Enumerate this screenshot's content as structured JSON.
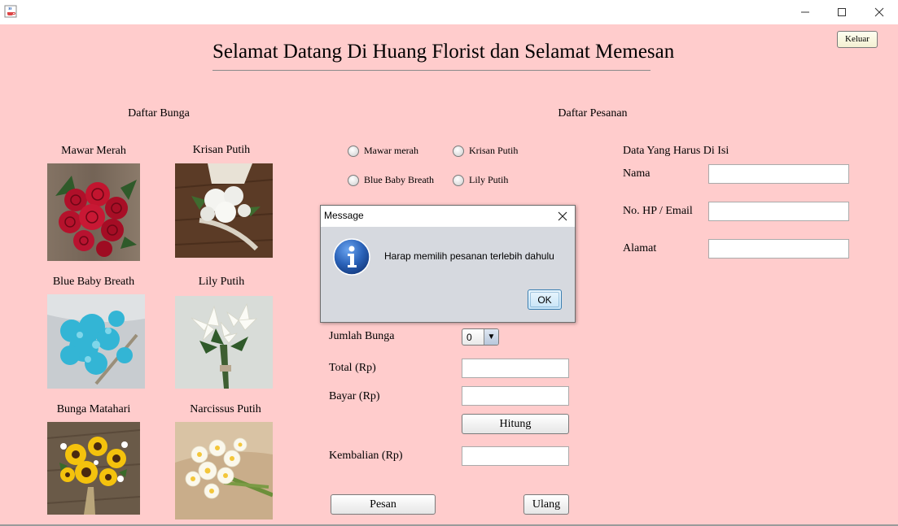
{
  "window": {
    "app_icon": "java-cup-icon",
    "controls": [
      "minimize-icon",
      "maximize-icon",
      "close-icon"
    ]
  },
  "header": {
    "title": "Selamat Datang Di Huang Florist dan Selamat Memesan",
    "exit_label": "Keluar"
  },
  "flowers": {
    "section_label": "Daftar Bunga",
    "items": [
      {
        "name": "Mawar Merah"
      },
      {
        "name": "Krisan Putih"
      },
      {
        "name": "Blue Baby Breath"
      },
      {
        "name": "Lily Putih"
      },
      {
        "name": "Bunga Matahari"
      },
      {
        "name": "Narcissus Putih"
      }
    ]
  },
  "order": {
    "section_label": "Daftar Pesanan",
    "options": [
      "Mawar merah",
      "Krisan Putih",
      "Blue Baby Breath",
      "Lily Putih"
    ],
    "quantity_label": "Jumlah Bunga",
    "quantity_value": "0",
    "total_label": "Total (Rp)",
    "pay_label": "Bayar (Rp)",
    "calc_label": "Hitung",
    "change_label": "Kembalian (Rp)",
    "order_label": "Pesan",
    "reset_label": "Ulang"
  },
  "customer": {
    "section_label": "Data Yang Harus Di Isi",
    "name_label": "Nama",
    "contact_label": "No. HP / Email",
    "address_label": "Alamat"
  },
  "dialog": {
    "title": "Message",
    "icon": "info-icon",
    "message": "Harap memilih pesanan terlebih dahulu",
    "ok_label": "OK"
  },
  "colors": {
    "background": "#ffcccc",
    "dialog_background": "#d6d9df",
    "info_icon": "#2a62b8"
  }
}
